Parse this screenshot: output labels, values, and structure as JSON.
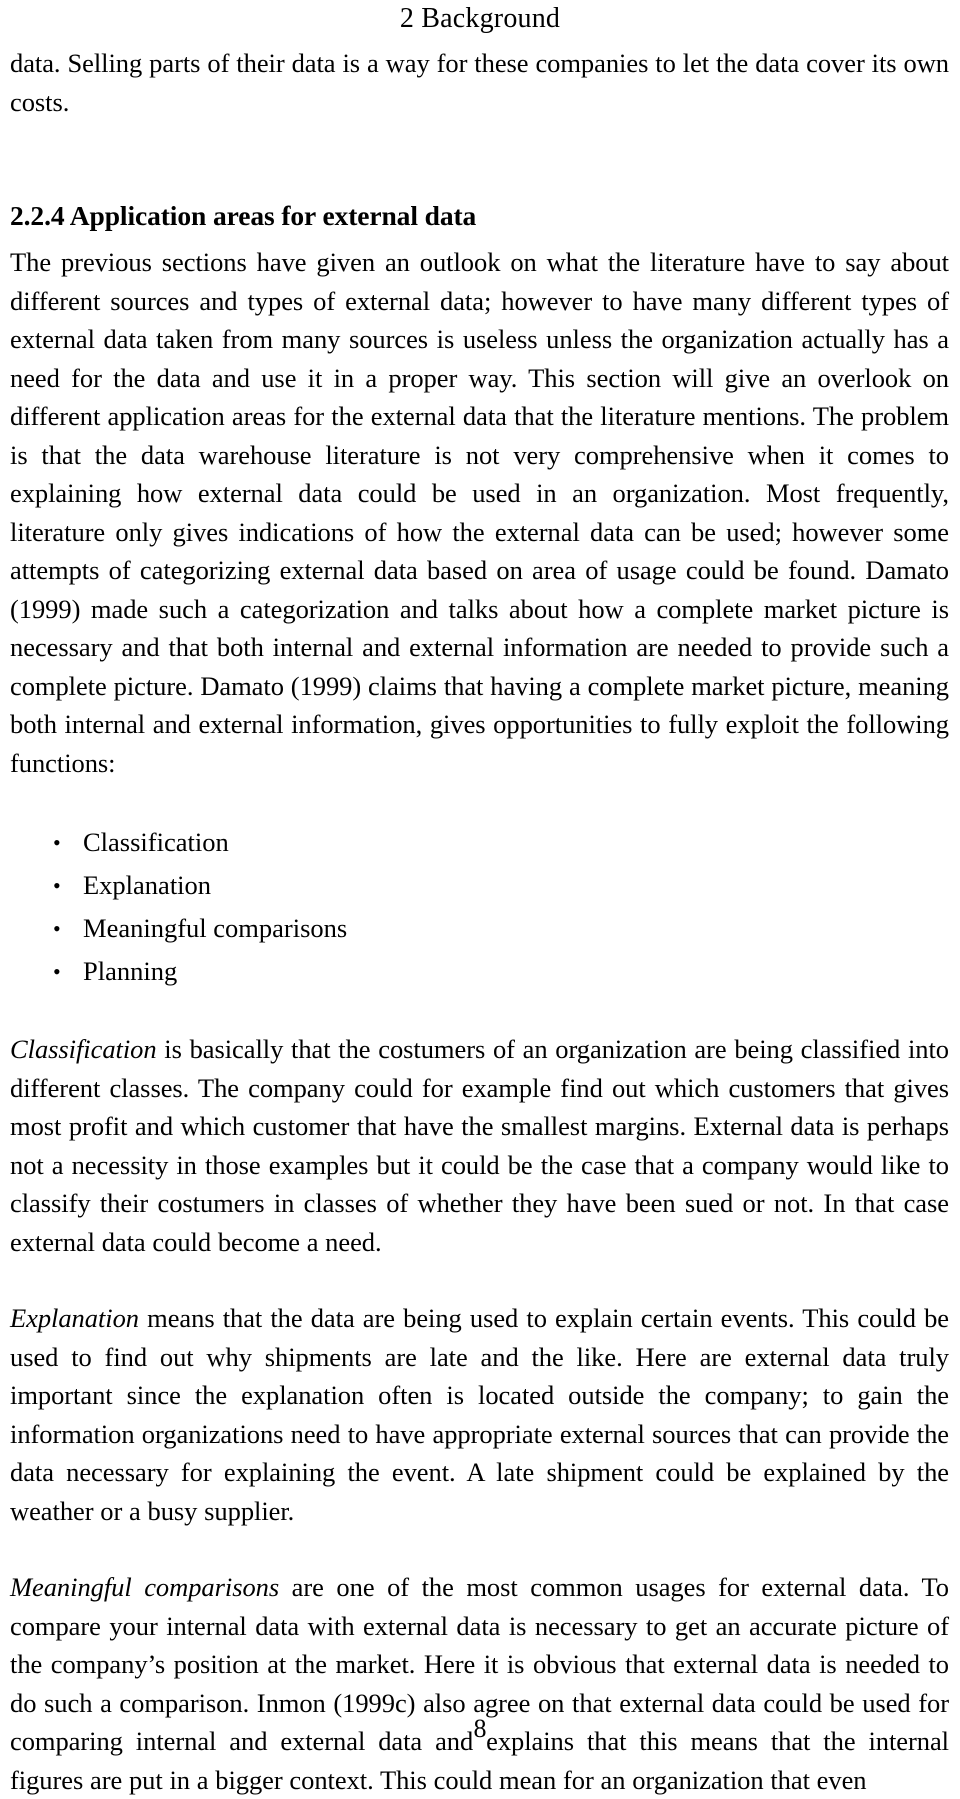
{
  "document": {
    "running_header": "2 Background",
    "page_number": "8"
  },
  "content": {
    "continued_paragraph": "data. Selling parts of their data is a way for these companies to let the data cover its own costs.",
    "section": {
      "number_and_title": "2.2.4 Application areas for external data",
      "intro_paragraph": "The previous sections have given an outlook on what the literature have to say about different sources and types of external data; however to have many different types of external data taken from many sources is useless unless the organization actually has a need for the data and use it in a proper way. This section will give an overlook on different application areas for the external data that the literature mentions. The problem is that the data warehouse literature is not very comprehensive when it comes to explaining how external data could be used in an organization. Most frequently, literature only gives indications of how the external data can be used; however some attempts of categorizing external data based on area of usage could be found. Damato (1999) made such a categorization and talks about how a complete market picture is necessary and that both internal and external information are needed to provide such a complete picture. Damato (1999) claims that having a complete market picture, meaning both internal and external information, gives opportunities to fully exploit the following functions:"
    },
    "function_list": {
      "bullet_glyph": "•",
      "items": [
        "Classification",
        "Explanation",
        "Meaningful comparisons",
        "Planning"
      ]
    },
    "definitions": [
      {
        "term": "Classification",
        "text": " is basically that the costumers of an organization are being classified into different classes. The company could for example find out which customers that gives most profit and which customer that have the smallest margins. External data is perhaps not a necessity in those examples but it could be the case that a company would like to classify their costumers in classes of whether they have been sued or not. In that case external data could become a need."
      },
      {
        "term": "Explanation",
        "text": " means that the data are being used to explain certain events. This could be used to find out why shipments are late and the like. Here are external data truly important since the explanation often is located outside the company; to gain the information organizations need to have appropriate external sources that can provide the data necessary for explaining the event. A late shipment could be explained by the weather or a busy supplier."
      },
      {
        "term": "Meaningful comparisons",
        "text": " are one of the most common usages for external data. To compare your internal data with external data is necessary to get an accurate picture of the company’s position at the market. Here it is obvious that external data is needed to do such a comparison. Inmon (1999c) also agree on that external data could be used for comparing internal and external data and explains that this means that the internal figures are put in a bigger context. This could mean for an organization that even"
      }
    ]
  }
}
